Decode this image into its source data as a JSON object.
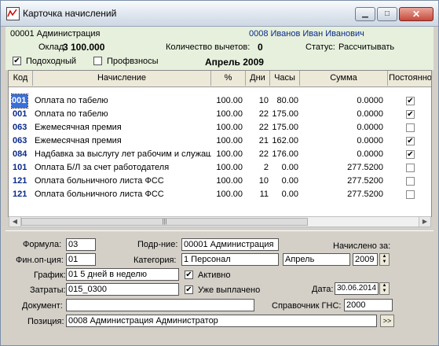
{
  "window": {
    "title": "Карточка начислений"
  },
  "header": {
    "department": "00001 Администрация",
    "employee": "0008 Иванов Иван Иванович",
    "salary_label": "Оклад",
    "salary_value": "3 100.000",
    "deductions_label": "Количество вычетов:",
    "deductions_value": "0",
    "status_label": "Статус:",
    "status_value": "Рассчитывать",
    "income_tax_label": "Подоходный",
    "income_tax_checked": true,
    "union_label": "Профвзносы",
    "union_checked": false,
    "period": "Апрель 2009"
  },
  "grid": {
    "columns": [
      "Код",
      "Начисление",
      "%",
      "Дни",
      "Часы",
      "Сумма",
      "Постоянно"
    ],
    "rows": [
      {
        "code": "001",
        "name": "Оплата по табелю",
        "pct": "100.00",
        "days": "10",
        "hours": "80.00",
        "sum": "0.0000",
        "permanent": true
      },
      {
        "code": "001",
        "name": "Оплата по табелю",
        "pct": "100.00",
        "days": "22",
        "hours": "175.00",
        "sum": "0.0000",
        "permanent": true
      },
      {
        "code": "063",
        "name": "Ежемесячная премия",
        "pct": "100.00",
        "days": "22",
        "hours": "175.00",
        "sum": "0.0000",
        "permanent": false
      },
      {
        "code": "063",
        "name": "Ежемесячная премия",
        "pct": "100.00",
        "days": "21",
        "hours": "162.00",
        "sum": "0.0000",
        "permanent": true
      },
      {
        "code": "084",
        "name": "Надбавка за выслугу лет рабочим и служащим",
        "pct": "100.00",
        "days": "22",
        "hours": "176.00",
        "sum": "0.0000",
        "permanent": true
      },
      {
        "code": "101",
        "name": "Оплата Б/Л за счет работодателя",
        "pct": "100.00",
        "days": "2",
        "hours": "0.00",
        "sum": "277.5200",
        "permanent": false
      },
      {
        "code": "121",
        "name": "Оплата больничного листа ФСС",
        "pct": "100.00",
        "days": "10",
        "hours": "0.00",
        "sum": "277.5200",
        "permanent": false
      },
      {
        "code": "121",
        "name": "Оплата больничного листа ФСС",
        "pct": "100.00",
        "days": "11",
        "hours": "0.00",
        "sum": "277.5200",
        "permanent": false
      }
    ]
  },
  "form": {
    "formula_label": "Формула:",
    "formula_value": "03",
    "unit_label": "Подр-ние:",
    "unit_value": "00001 Администрация",
    "accrued_label": "Начислено за:",
    "finop_label": "Фин.оп-ция:",
    "finop_value": "01",
    "category_label": "Категория:",
    "category_value": "1  Персонал",
    "month_value": "Апрель",
    "year_value": "2009",
    "schedule_label": "График:",
    "schedule_value": "01 5 дней в неделю",
    "active_label": "Активно",
    "active_checked": true,
    "costs_label": "Затраты:",
    "costs_value": "015_0300",
    "paid_label": "Уже выплачено",
    "paid_checked": true,
    "date_label": "Дата:",
    "date_value": "30.06.2014",
    "doc_label": "Документ:",
    "doc_value": "",
    "gns_label": "Справочник ГНС:",
    "gns_value": "2000",
    "position_label": "Позиция:",
    "position_value": "0008 Администрация Администратор",
    "position_btn": ">>"
  }
}
